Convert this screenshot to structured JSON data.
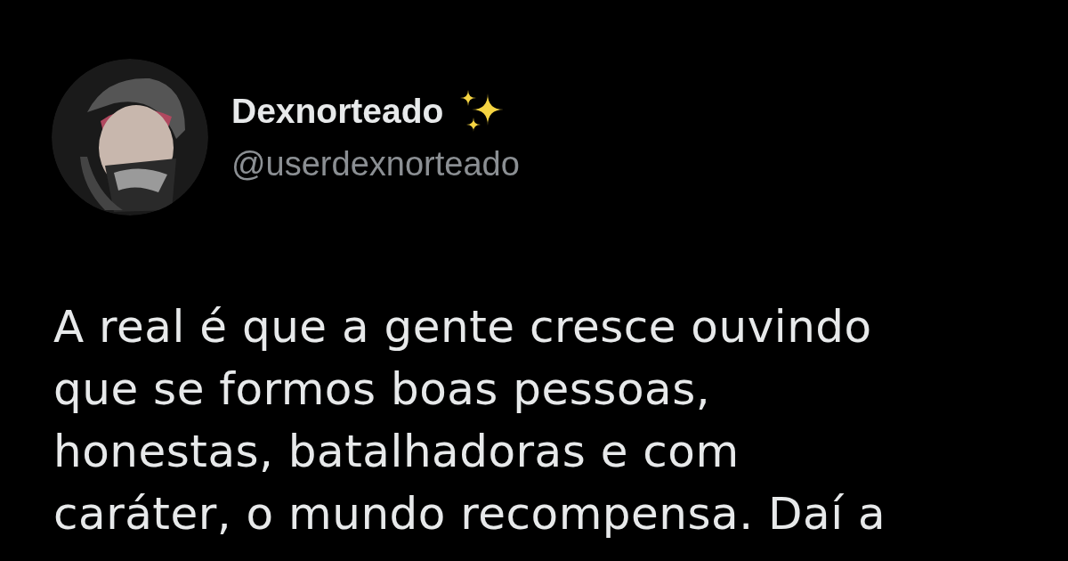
{
  "tweet": {
    "author": {
      "name": "Dexnorteado",
      "handle": "@userdexnorteado"
    },
    "text_lines": [
      "A real é que a gente cresce ouvindo",
      "que se formos boas pessoas,",
      "honestas, batalhadoras e com",
      "caráter, o mundo recompensa. Daí a"
    ]
  }
}
